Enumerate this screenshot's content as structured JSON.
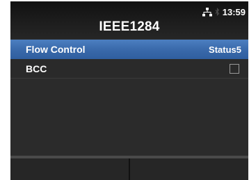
{
  "header": {
    "title": "IEEE1284",
    "clock": "13:59",
    "network_icon": "network-icon",
    "bluetooth_icon": "bluetooth-icon"
  },
  "settings": {
    "items": [
      {
        "label": "Flow Control",
        "value": "Status5",
        "selected": true
      },
      {
        "label": "BCC",
        "checked": false
      }
    ]
  },
  "footer": {
    "left_key_label": "",
    "right_key_label": ""
  },
  "colors": {
    "background": "#2d2d2d",
    "selection": "#3a6aab",
    "text": "#ffffff"
  }
}
